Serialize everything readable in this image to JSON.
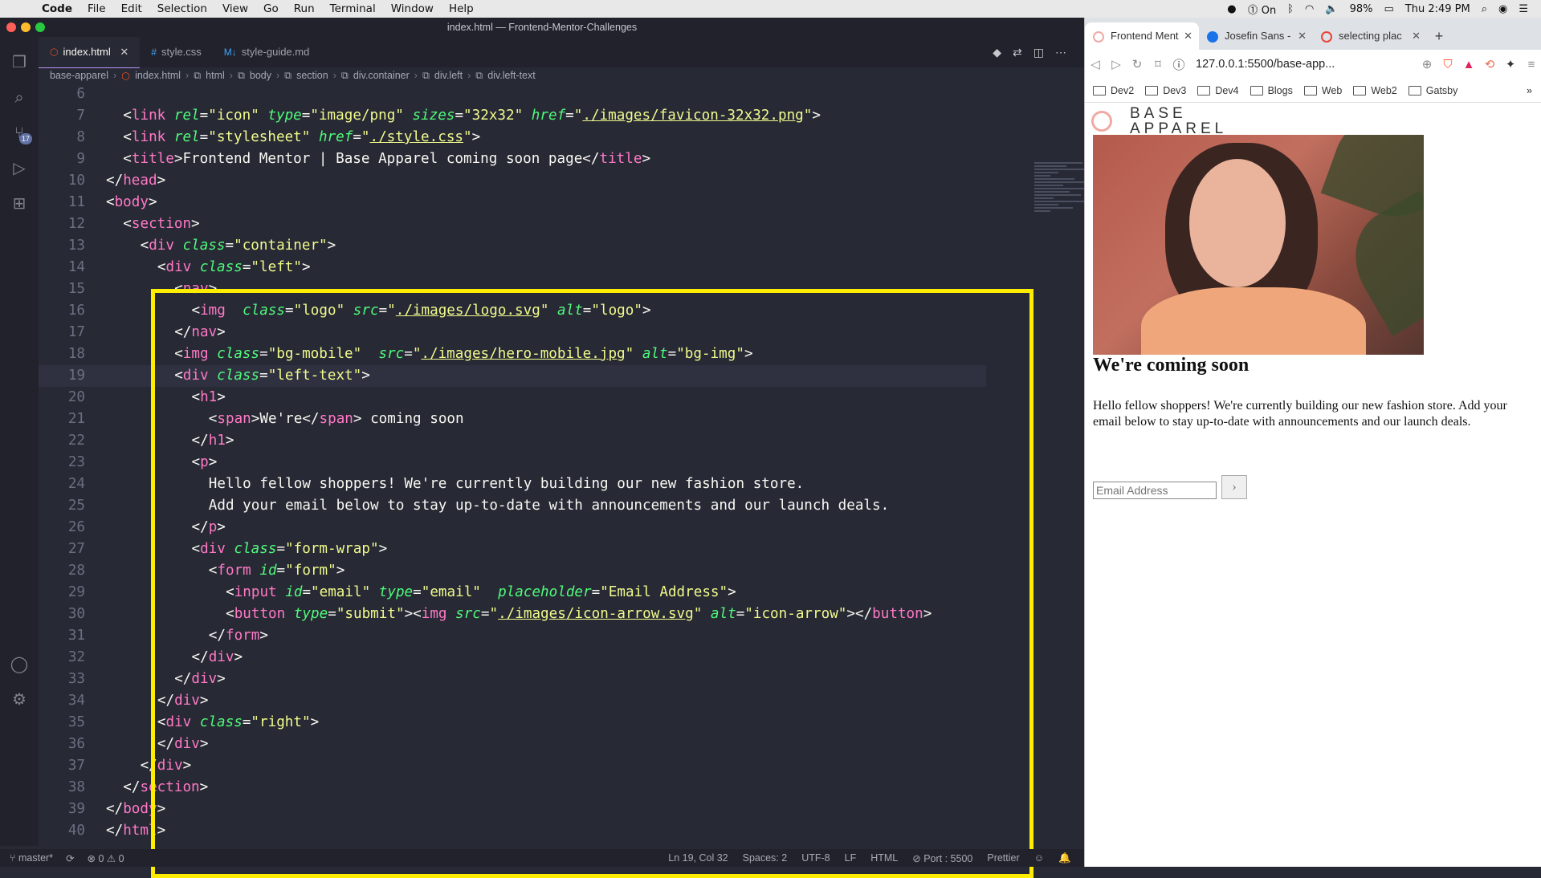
{
  "menubar": {
    "app_name": "Code",
    "items": [
      "File",
      "Edit",
      "Selection",
      "View",
      "Go",
      "Run",
      "Terminal",
      "Window",
      "Help"
    ],
    "right": {
      "toggle": "On",
      "battery": "98%",
      "clock": "Thu 2:49 PM"
    }
  },
  "vscode": {
    "window_title": "index.html — Frontend-Mentor-Challenges",
    "source_control_badge": "17",
    "tabs": [
      {
        "label": "index.html",
        "active": true
      },
      {
        "label": "style.css",
        "active": false
      },
      {
        "label": "style-guide.md",
        "active": false
      }
    ],
    "breadcrumb": [
      "base-apparel",
      "index.html",
      "html",
      "body",
      "section",
      "div.container",
      "div.left",
      "div.left-text"
    ],
    "status": {
      "branch": "master*",
      "problems": "⊗ 0 ⚠ 0",
      "position": "Ln 19, Col 32",
      "spaces": "Spaces: 2",
      "encoding": "UTF-8",
      "eol": "LF",
      "language": "HTML",
      "port": "Port : 5500",
      "formatter": "Prettier"
    }
  },
  "code_lines": [
    {
      "n": "6",
      "indent": 0,
      "tokens": []
    },
    {
      "n": "7",
      "indent": 1,
      "tokens": [
        [
          "t-punc",
          "<"
        ],
        [
          "t-tag",
          "link"
        ],
        [
          "t-txt",
          " "
        ],
        [
          "t-attr",
          "rel"
        ],
        [
          "t-punc",
          "="
        ],
        [
          "t-str",
          "\"icon\""
        ],
        [
          "t-txt",
          " "
        ],
        [
          "t-attr",
          "type"
        ],
        [
          "t-punc",
          "="
        ],
        [
          "t-str",
          "\"image/png\""
        ],
        [
          "t-txt",
          " "
        ],
        [
          "t-attr",
          "sizes"
        ],
        [
          "t-punc",
          "="
        ],
        [
          "t-str",
          "\"32x32\""
        ],
        [
          "t-txt",
          " "
        ],
        [
          "t-attr",
          "href"
        ],
        [
          "t-punc",
          "="
        ],
        [
          "t-str",
          "\""
        ],
        [
          "t-url",
          "./images/favicon-32x32.png"
        ],
        [
          "t-str",
          "\""
        ],
        [
          "t-punc",
          ">"
        ]
      ]
    },
    {
      "n": "8",
      "indent": 1,
      "tokens": [
        [
          "t-punc",
          "<"
        ],
        [
          "t-tag",
          "link"
        ],
        [
          "t-txt",
          " "
        ],
        [
          "t-attr",
          "rel"
        ],
        [
          "t-punc",
          "="
        ],
        [
          "t-str",
          "\"stylesheet\""
        ],
        [
          "t-txt",
          " "
        ],
        [
          "t-attr",
          "href"
        ],
        [
          "t-punc",
          "="
        ],
        [
          "t-str",
          "\""
        ],
        [
          "t-url",
          "./style.css"
        ],
        [
          "t-str",
          "\""
        ],
        [
          "t-punc",
          ">"
        ]
      ]
    },
    {
      "n": "9",
      "indent": 1,
      "tokens": [
        [
          "t-punc",
          "<"
        ],
        [
          "t-tag",
          "title"
        ],
        [
          "t-punc",
          ">"
        ],
        [
          "t-txt",
          "Frontend Mentor | Base Apparel coming soon page"
        ],
        [
          "t-punc",
          "</"
        ],
        [
          "t-tag",
          "title"
        ],
        [
          "t-punc",
          ">"
        ]
      ]
    },
    {
      "n": "10",
      "indent": 0,
      "tokens": [
        [
          "t-punc",
          "</"
        ],
        [
          "t-tag",
          "head"
        ],
        [
          "t-punc",
          ">"
        ]
      ]
    },
    {
      "n": "11",
      "indent": 0,
      "tokens": [
        [
          "t-punc",
          "<"
        ],
        [
          "t-tag",
          "body"
        ],
        [
          "t-punc",
          ">"
        ]
      ]
    },
    {
      "n": "12",
      "indent": 1,
      "tokens": [
        [
          "t-punc",
          "<"
        ],
        [
          "t-tag",
          "section"
        ],
        [
          "t-punc",
          ">"
        ]
      ]
    },
    {
      "n": "13",
      "indent": 2,
      "tokens": [
        [
          "t-punc",
          "<"
        ],
        [
          "t-tag",
          "div"
        ],
        [
          "t-txt",
          " "
        ],
        [
          "t-attr",
          "class"
        ],
        [
          "t-punc",
          "="
        ],
        [
          "t-str",
          "\"container\""
        ],
        [
          "t-punc",
          ">"
        ]
      ]
    },
    {
      "n": "14",
      "indent": 3,
      "tokens": [
        [
          "t-punc",
          "<"
        ],
        [
          "t-tag",
          "div"
        ],
        [
          "t-txt",
          " "
        ],
        [
          "t-attr",
          "class"
        ],
        [
          "t-punc",
          "="
        ],
        [
          "t-str",
          "\"left\""
        ],
        [
          "t-punc",
          ">"
        ]
      ]
    },
    {
      "n": "15",
      "indent": 4,
      "tokens": [
        [
          "t-punc",
          "<"
        ],
        [
          "t-tag",
          "nav"
        ],
        [
          "t-punc",
          ">"
        ]
      ]
    },
    {
      "n": "16",
      "indent": 5,
      "tokens": [
        [
          "t-punc",
          "<"
        ],
        [
          "t-tag",
          "img"
        ],
        [
          "t-txt",
          "  "
        ],
        [
          "t-attr",
          "class"
        ],
        [
          "t-punc",
          "="
        ],
        [
          "t-str",
          "\"logo\""
        ],
        [
          "t-txt",
          " "
        ],
        [
          "t-attr",
          "src"
        ],
        [
          "t-punc",
          "="
        ],
        [
          "t-str",
          "\""
        ],
        [
          "t-url",
          "./images/logo.svg"
        ],
        [
          "t-str",
          "\""
        ],
        [
          "t-txt",
          " "
        ],
        [
          "t-attr",
          "alt"
        ],
        [
          "t-punc",
          "="
        ],
        [
          "t-str",
          "\"logo\""
        ],
        [
          "t-punc",
          ">"
        ]
      ]
    },
    {
      "n": "17",
      "indent": 4,
      "tokens": [
        [
          "t-punc",
          "</"
        ],
        [
          "t-tag",
          "nav"
        ],
        [
          "t-punc",
          ">"
        ]
      ]
    },
    {
      "n": "18",
      "indent": 4,
      "tokens": [
        [
          "t-punc",
          "<"
        ],
        [
          "t-tag",
          "img"
        ],
        [
          "t-txt",
          " "
        ],
        [
          "t-attr",
          "class"
        ],
        [
          "t-punc",
          "="
        ],
        [
          "t-str",
          "\"bg-mobile\""
        ],
        [
          "t-txt",
          "  "
        ],
        [
          "t-attr",
          "src"
        ],
        [
          "t-punc",
          "="
        ],
        [
          "t-str",
          "\""
        ],
        [
          "t-url",
          "./images/hero-mobile.jpg"
        ],
        [
          "t-str",
          "\""
        ],
        [
          "t-txt",
          " "
        ],
        [
          "t-attr",
          "alt"
        ],
        [
          "t-punc",
          "="
        ],
        [
          "t-str",
          "\"bg-img\""
        ],
        [
          "t-punc",
          ">"
        ]
      ]
    },
    {
      "n": "19",
      "indent": 4,
      "current": true,
      "tokens": [
        [
          "t-punc",
          "<"
        ],
        [
          "t-tag",
          "div"
        ],
        [
          "t-txt",
          " "
        ],
        [
          "t-attr",
          "class"
        ],
        [
          "t-punc",
          "="
        ],
        [
          "t-str",
          "\"left-text\""
        ],
        [
          "t-punc",
          ">"
        ]
      ]
    },
    {
      "n": "20",
      "indent": 5,
      "tokens": [
        [
          "t-punc",
          "<"
        ],
        [
          "t-tag",
          "h1"
        ],
        [
          "t-punc",
          ">"
        ]
      ]
    },
    {
      "n": "21",
      "indent": 6,
      "tokens": [
        [
          "t-punc",
          "<"
        ],
        [
          "t-tag",
          "span"
        ],
        [
          "t-punc",
          ">"
        ],
        [
          "t-txt",
          "We're"
        ],
        [
          "t-punc",
          "</"
        ],
        [
          "t-tag",
          "span"
        ],
        [
          "t-punc",
          ">"
        ],
        [
          "t-txt",
          " coming soon"
        ]
      ]
    },
    {
      "n": "22",
      "indent": 5,
      "tokens": [
        [
          "t-punc",
          "</"
        ],
        [
          "t-tag",
          "h1"
        ],
        [
          "t-punc",
          ">"
        ]
      ]
    },
    {
      "n": "23",
      "indent": 5,
      "tokens": [
        [
          "t-punc",
          "<"
        ],
        [
          "t-tag",
          "p"
        ],
        [
          "t-punc",
          ">"
        ]
      ]
    },
    {
      "n": "24",
      "indent": 6,
      "tokens": [
        [
          "t-txt",
          "Hello fellow shoppers! We're currently building our new fashion store."
        ]
      ]
    },
    {
      "n": "25",
      "indent": 6,
      "tokens": [
        [
          "t-txt",
          "Add your email below to stay up-to-date with announcements and our launch deals."
        ]
      ]
    },
    {
      "n": "26",
      "indent": 5,
      "tokens": [
        [
          "t-punc",
          "</"
        ],
        [
          "t-tag",
          "p"
        ],
        [
          "t-punc",
          ">"
        ]
      ]
    },
    {
      "n": "27",
      "indent": 5,
      "tokens": [
        [
          "t-punc",
          "<"
        ],
        [
          "t-tag",
          "div"
        ],
        [
          "t-txt",
          " "
        ],
        [
          "t-attr",
          "class"
        ],
        [
          "t-punc",
          "="
        ],
        [
          "t-str",
          "\"form-wrap\""
        ],
        [
          "t-punc",
          ">"
        ]
      ]
    },
    {
      "n": "28",
      "indent": 6,
      "tokens": [
        [
          "t-punc",
          "<"
        ],
        [
          "t-tag",
          "form"
        ],
        [
          "t-txt",
          " "
        ],
        [
          "t-attr",
          "id"
        ],
        [
          "t-punc",
          "="
        ],
        [
          "t-str",
          "\"form\""
        ],
        [
          "t-punc",
          ">"
        ]
      ]
    },
    {
      "n": "29",
      "indent": 7,
      "tokens": [
        [
          "t-punc",
          "<"
        ],
        [
          "t-tag",
          "input"
        ],
        [
          "t-txt",
          " "
        ],
        [
          "t-attr",
          "id"
        ],
        [
          "t-punc",
          "="
        ],
        [
          "t-str",
          "\"email\""
        ],
        [
          "t-txt",
          " "
        ],
        [
          "t-attr",
          "type"
        ],
        [
          "t-punc",
          "="
        ],
        [
          "t-str",
          "\"email\""
        ],
        [
          "t-txt",
          "  "
        ],
        [
          "t-attr",
          "placeholder"
        ],
        [
          "t-punc",
          "="
        ],
        [
          "t-str",
          "\"Email Address\""
        ],
        [
          "t-punc",
          ">"
        ]
      ]
    },
    {
      "n": "30",
      "indent": 7,
      "tokens": [
        [
          "t-punc",
          "<"
        ],
        [
          "t-tag",
          "button"
        ],
        [
          "t-txt",
          " "
        ],
        [
          "t-attr",
          "type"
        ],
        [
          "t-punc",
          "="
        ],
        [
          "t-str",
          "\"submit\""
        ],
        [
          "t-punc",
          "><"
        ],
        [
          "t-tag",
          "img"
        ],
        [
          "t-txt",
          " "
        ],
        [
          "t-attr",
          "src"
        ],
        [
          "t-punc",
          "="
        ],
        [
          "t-str",
          "\""
        ],
        [
          "t-url",
          "./images/icon-arrow.svg"
        ],
        [
          "t-str",
          "\""
        ],
        [
          "t-txt",
          " "
        ],
        [
          "t-attr",
          "alt"
        ],
        [
          "t-punc",
          "="
        ],
        [
          "t-str",
          "\"icon-arrow\""
        ],
        [
          "t-punc",
          "></"
        ],
        [
          "t-tag",
          "button"
        ],
        [
          "t-punc",
          ">"
        ]
      ]
    },
    {
      "n": "31",
      "indent": 6,
      "tokens": [
        [
          "t-punc",
          "</"
        ],
        [
          "t-tag",
          "form"
        ],
        [
          "t-punc",
          ">"
        ]
      ]
    },
    {
      "n": "32",
      "indent": 5,
      "tokens": [
        [
          "t-punc",
          "</"
        ],
        [
          "t-tag",
          "div"
        ],
        [
          "t-punc",
          ">"
        ]
      ]
    },
    {
      "n": "33",
      "indent": 4,
      "tokens": [
        [
          "t-punc",
          "</"
        ],
        [
          "t-tag",
          "div"
        ],
        [
          "t-punc",
          ">"
        ]
      ]
    },
    {
      "n": "34",
      "indent": 3,
      "tokens": [
        [
          "t-punc",
          "</"
        ],
        [
          "t-tag",
          "div"
        ],
        [
          "t-punc",
          ">"
        ]
      ]
    },
    {
      "n": "35",
      "indent": 3,
      "tokens": [
        [
          "t-punc",
          "<"
        ],
        [
          "t-tag",
          "div"
        ],
        [
          "t-txt",
          " "
        ],
        [
          "t-attr",
          "class"
        ],
        [
          "t-punc",
          "="
        ],
        [
          "t-str",
          "\"right\""
        ],
        [
          "t-punc",
          ">"
        ]
      ]
    },
    {
      "n": "36",
      "indent": 3,
      "tokens": [
        [
          "t-punc",
          "</"
        ],
        [
          "t-tag",
          "div"
        ],
        [
          "t-punc",
          ">"
        ]
      ]
    },
    {
      "n": "37",
      "indent": 2,
      "tokens": [
        [
          "t-punc",
          "</"
        ],
        [
          "t-tag",
          "div"
        ],
        [
          "t-punc",
          ">"
        ]
      ]
    },
    {
      "n": "38",
      "indent": 1,
      "tokens": [
        [
          "t-punc",
          "</"
        ],
        [
          "t-tag",
          "section"
        ],
        [
          "t-punc",
          ">"
        ]
      ]
    },
    {
      "n": "39",
      "indent": 0,
      "tokens": [
        [
          "t-punc",
          "</"
        ],
        [
          "t-tag",
          "body"
        ],
        [
          "t-punc",
          ">"
        ]
      ]
    },
    {
      "n": "40",
      "indent": 0,
      "tokens": [
        [
          "t-punc",
          "</"
        ],
        [
          "t-tag",
          "html"
        ],
        [
          "t-punc",
          ">"
        ]
      ]
    }
  ],
  "browser": {
    "tabs": [
      {
        "label": "Frontend Ment",
        "active": true,
        "fav_color": "#f0a9a3"
      },
      {
        "label": "Josefin Sans -",
        "active": false,
        "fav_color": "#1a73e8"
      },
      {
        "label": "selecting plac",
        "active": false,
        "fav_color": "#ea4335"
      }
    ],
    "url": "127.0.0.1:5500/base-app...",
    "bookmarks": [
      "Dev2",
      "Dev3",
      "Dev4",
      "Blogs",
      "Web",
      "Web2",
      "Gatsby"
    ],
    "page": {
      "logo_line1": "BASE",
      "logo_line2": "APPAREL",
      "heading": "We're coming soon",
      "paragraph": "Hello fellow shoppers! We're currently building our new fashion store. Add your email below to stay up-to-date with announcements and our launch deals.",
      "email_placeholder": "Email Address",
      "submit_glyph": "›"
    }
  }
}
